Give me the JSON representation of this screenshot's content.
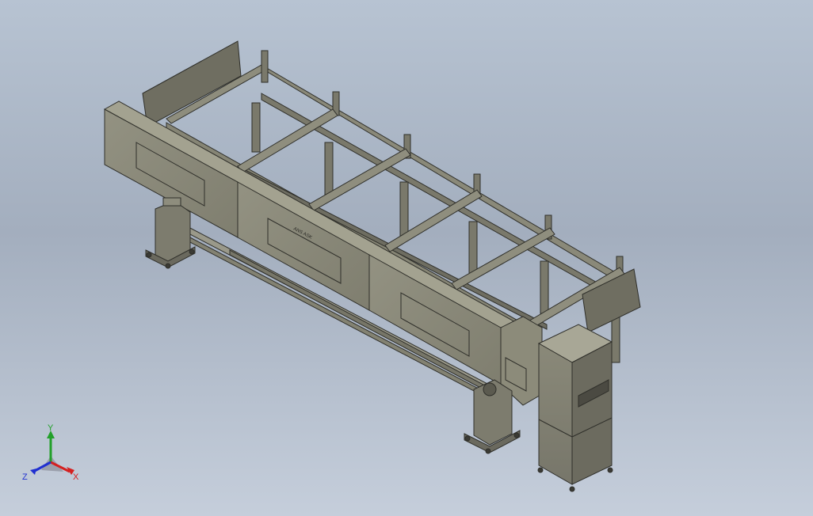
{
  "model": {
    "nameplate": "ANS ASK",
    "colors": {
      "background_top": "#b7c3d2",
      "background_bottom": "#c5cedb",
      "steel": "#7d7c6e",
      "steel_dark": "#5b5a4f",
      "steel_light": "#a3a290",
      "panel": "#8c8b7a",
      "edge": "#2f2f2a"
    }
  },
  "triad": {
    "x_label": "X",
    "y_label": "Y",
    "z_label": "Z",
    "x_color": "#d42020",
    "y_color": "#22a02a",
    "z_color": "#2030d0"
  }
}
